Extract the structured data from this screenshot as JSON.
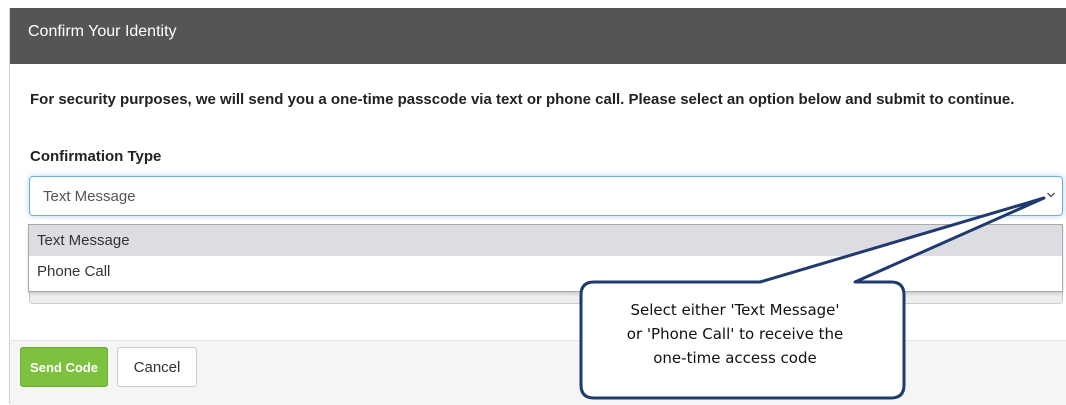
{
  "dialog": {
    "title": "Confirm Your Identity",
    "description": "For security purposes, we will send you a one-time passcode via text or phone call. Please select an option below and submit to continue.",
    "field_label": "Confirmation Type",
    "select": {
      "selected_value": "Text Message",
      "options": [
        "Text Message",
        "Phone Call"
      ]
    },
    "buttons": {
      "send_code": "Send Code",
      "cancel": "Cancel"
    }
  },
  "callout": {
    "lines": [
      "Select either 'Text Message'",
      "or 'Phone Call' to receive the",
      "one-time access code"
    ]
  },
  "colors": {
    "header_bg": "#555555",
    "send_button": "#7cc23f",
    "callout_border": "#1f3a6e",
    "focus_border": "#66afe9"
  }
}
